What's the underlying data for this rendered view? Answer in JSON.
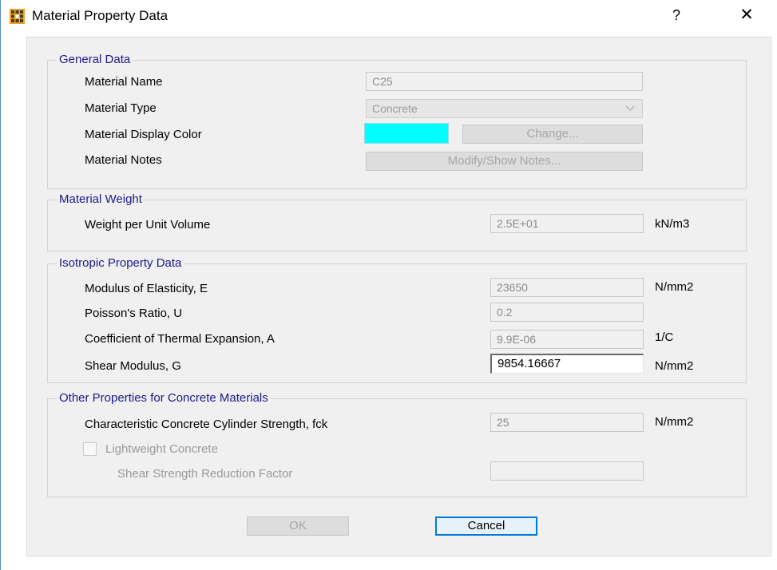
{
  "window": {
    "title": "Material Property Data",
    "help_label": "?",
    "close_label": "✕",
    "icon": "app-grid-icon"
  },
  "general": {
    "title": "General Data",
    "name_label": "Material Name",
    "name_value": "C25",
    "type_label": "Material Type",
    "type_value": "Concrete",
    "color_label": "Material Display Color",
    "display_color": "#00ffff",
    "change_label": "Change...",
    "notes_label": "Material Notes",
    "notes_button": "Modify/Show Notes..."
  },
  "weight": {
    "title": "Material Weight",
    "wpuv_label": "Weight per Unit Volume",
    "wpuv_value": "2.5E+01",
    "wpuv_unit": "kN/m3"
  },
  "isotropic": {
    "title": "Isotropic Property Data",
    "e_label": "Modulus of Elasticity,  E",
    "e_value": "23650",
    "e_unit": "N/mm2",
    "u_label": "Poisson's Ratio,  U",
    "u_value": "0.2",
    "a_label": "Coefficient of Thermal Expansion,  A",
    "a_value": "9.9E-06",
    "a_unit": "1/C",
    "g_label": "Shear Modulus,  G",
    "g_value": "9854.16667",
    "g_unit": "N/mm2"
  },
  "concrete": {
    "title": "Other Properties for Concrete Materials",
    "fck_label": "Characteristic Concrete Cylinder Strength, fck",
    "fck_value": "25",
    "fck_unit": "N/mm2",
    "lightweight_label": "Lightweight Concrete",
    "lightweight_checked": false,
    "ssrf_label": "Shear Strength Reduction Factor",
    "ssrf_value": ""
  },
  "footer": {
    "ok_label": "OK",
    "cancel_label": "Cancel"
  },
  "colors": {
    "accent": "#0078d7",
    "group_title": "#1a1a8c"
  }
}
